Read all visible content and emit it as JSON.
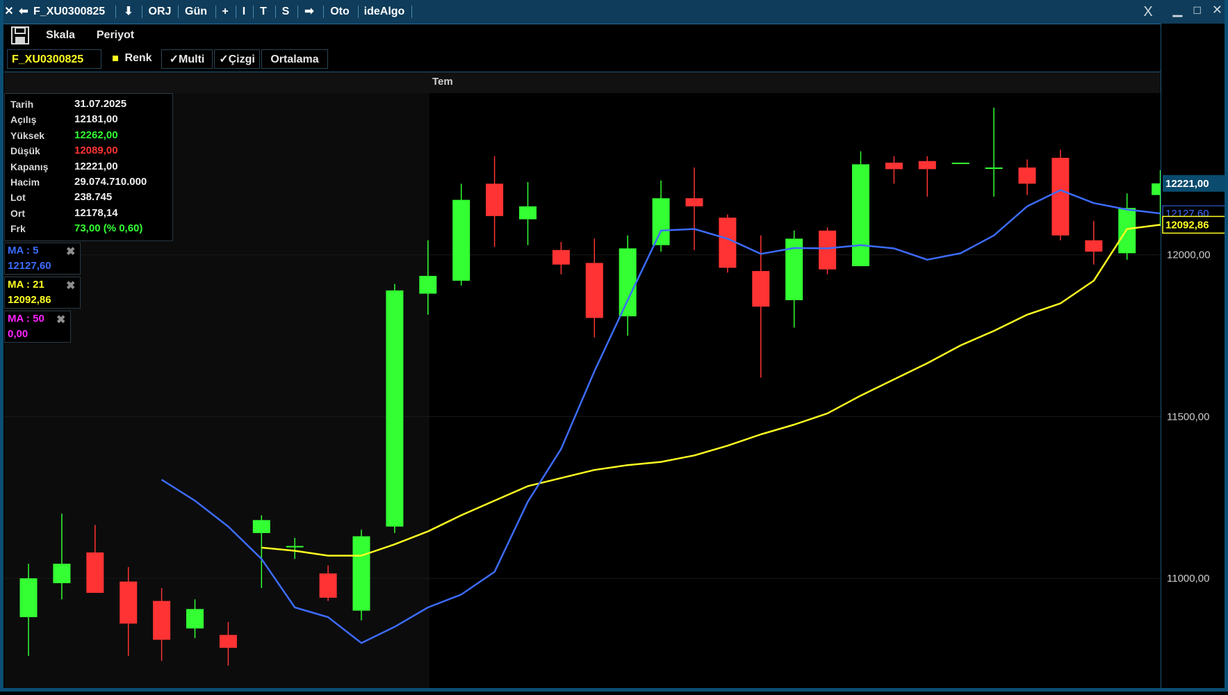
{
  "titlebar": {
    "symbol": "F_XU0300825",
    "items": [
      "ORJ",
      "Gün",
      "+",
      "I",
      "T",
      "S",
      "Oto",
      "ideAlgo"
    ],
    "close_x": "X"
  },
  "toolbar1": {
    "scale_label": "Skala",
    "period_label": "Periyot"
  },
  "toolbar2": {
    "symbol_field": "F_XU0300825",
    "color_label": "Renk",
    "multi_label": "✓Multi",
    "line_label": "✓Çizgi",
    "average_label": "Ortalama"
  },
  "time_axis": {
    "month_label": "Tem"
  },
  "info_panel": {
    "rows": [
      {
        "label": "Tarih",
        "value": "31.07.2025",
        "color": "#f0f0f0"
      },
      {
        "label": "Açılış",
        "value": "12181,00",
        "color": "#f0f0f0"
      },
      {
        "label": "Yüksek",
        "value": "12262,00",
        "color": "#33ff33"
      },
      {
        "label": "Düşük",
        "value": "12089,00",
        "color": "#ff3333"
      },
      {
        "label": "Kapanış",
        "value": "12221,00",
        "color": "#f0f0f0"
      },
      {
        "label": "Hacim",
        "value": "29.074.710.000",
        "color": "#f0f0f0"
      },
      {
        "label": "Lot",
        "value": "238.745",
        "color": "#f0f0f0"
      },
      {
        "label": "Ort",
        "value": "12178,14",
        "color": "#f0f0f0"
      },
      {
        "label": "Frk",
        "value": "73,00 (% 0,60)",
        "color": "#33ff33"
      }
    ]
  },
  "ma_legend": [
    {
      "label": "MA : 5",
      "value": "12127,60",
      "color": "#3d6cff"
    },
    {
      "label": "MA : 21",
      "value": "12092,86",
      "color": "#ffff22"
    },
    {
      "label": "MA : 50",
      "value": "0,00",
      "color": "#ff22ff"
    }
  ],
  "price_axis": {
    "ticks": [
      {
        "price": 12000,
        "label": "12000,00"
      },
      {
        "price": 11500,
        "label": "11500,00"
      },
      {
        "price": 11000,
        "label": "11000,00"
      }
    ],
    "last_price_label": "12221,00",
    "ma5_label": "12127,60",
    "ma21_label": "12092,86"
  },
  "colors": {
    "up": "#33ff33",
    "down": "#ff3333",
    "ma5": "#3d6cff",
    "ma21": "#ffff22",
    "last_price_bg": "#0a4b6e",
    "background": "#000000"
  },
  "chart_data": {
    "type": "candlestick",
    "ylim": [
      10650,
      12500
    ],
    "candles": [
      {
        "o": 10880,
        "h": 11045,
        "l": 10760,
        "c": 11000
      },
      {
        "o": 10985,
        "h": 11200,
        "l": 10935,
        "c": 11045
      },
      {
        "o": 11080,
        "h": 11165,
        "l": 10960,
        "c": 10955
      },
      {
        "o": 10990,
        "h": 11035,
        "l": 10760,
        "c": 10860
      },
      {
        "o": 10930,
        "h": 10970,
        "l": 10745,
        "c": 10810
      },
      {
        "o": 10845,
        "h": 10935,
        "l": 10815,
        "c": 10905
      },
      {
        "o": 10825,
        "h": 10865,
        "l": 10730,
        "c": 10785
      },
      {
        "o": 11140,
        "h": 11195,
        "l": 10970,
        "c": 11180
      },
      {
        "o": 11100,
        "h": 11125,
        "l": 11060,
        "c": 11100
      },
      {
        "o": 11015,
        "h": 11040,
        "l": 10930,
        "c": 10940
      },
      {
        "o": 10900,
        "h": 11150,
        "l": 10870,
        "c": 11130
      },
      {
        "o": 11160,
        "h": 11910,
        "l": 11140,
        "c": 11890
      },
      {
        "o": 11880,
        "h": 12045,
        "l": 11815,
        "c": 11935
      },
      {
        "o": 11920,
        "h": 12220,
        "l": 11905,
        "c": 12170
      },
      {
        "o": 12220,
        "h": 12305,
        "l": 12025,
        "c": 12120
      },
      {
        "o": 12110,
        "h": 12225,
        "l": 12030,
        "c": 12150
      },
      {
        "o": 12015,
        "h": 12040,
        "l": 11940,
        "c": 11970
      },
      {
        "o": 11975,
        "h": 12050,
        "l": 11745,
        "c": 11805
      },
      {
        "o": 11810,
        "h": 12060,
        "l": 11750,
        "c": 12020
      },
      {
        "o": 12030,
        "h": 12230,
        "l": 12010,
        "c": 12175
      },
      {
        "o": 12175,
        "h": 12270,
        "l": 12015,
        "c": 12150
      },
      {
        "o": 12115,
        "h": 12125,
        "l": 11945,
        "c": 11960
      },
      {
        "o": 11950,
        "h": 12060,
        "l": 11620,
        "c": 11840
      },
      {
        "o": 11860,
        "h": 12075,
        "l": 11775,
        "c": 12050
      },
      {
        "o": 12075,
        "h": 12085,
        "l": 11940,
        "c": 11955
      },
      {
        "o": 11965,
        "h": 12320,
        "l": 11965,
        "c": 12280
      },
      {
        "o": 12285,
        "h": 12305,
        "l": 12220,
        "c": 12265
      },
      {
        "o": 12290,
        "h": 12305,
        "l": 12180,
        "c": 12265
      },
      {
        "o": 12285,
        "h": 12285,
        "l": 12285,
        "c": 12285
      },
      {
        "o": 12270,
        "h": 12455,
        "l": 12180,
        "c": 12270
      },
      {
        "o": 12270,
        "h": 12295,
        "l": 12185,
        "c": 12220
      },
      {
        "o": 12300,
        "h": 12325,
        "l": 12045,
        "c": 12060
      },
      {
        "o": 12045,
        "h": 12105,
        "l": 11970,
        "c": 12010
      },
      {
        "o": 12005,
        "h": 12190,
        "l": 11985,
        "c": 12145
      },
      {
        "o": 12185,
        "h": 12262,
        "l": 12089,
        "c": 12221
      }
    ],
    "ma5": [
      null,
      null,
      null,
      null,
      11305,
      11240,
      11160,
      11060,
      10910,
      10880,
      10800,
      10850,
      10910,
      10950,
      11020,
      11237,
      11400,
      11640,
      11860,
      12075,
      12080,
      12050,
      12003,
      12021,
      12020,
      12030,
      12020,
      11985,
      12005,
      12060,
      12150,
      12200,
      12160,
      12140,
      12128
    ],
    "ma21": [
      null,
      null,
      null,
      null,
      null,
      null,
      null,
      11095,
      11085,
      11070,
      11070,
      11105,
      11145,
      11195,
      11240,
      11285,
      11310,
      11335,
      11350,
      11360,
      11380,
      11410,
      11445,
      11475,
      11510,
      11565,
      11615,
      11665,
      11720,
      11765,
      11815,
      11850,
      11920,
      12080,
      12093
    ]
  }
}
